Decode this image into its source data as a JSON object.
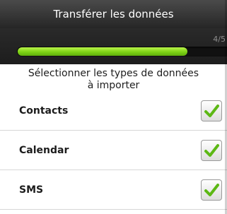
{
  "header": {
    "title": "Transférer les données"
  },
  "progress": {
    "step_label": "4/5",
    "fraction": 0.8
  },
  "panel": {
    "prompt_line1": "Sélectionner les types de données",
    "prompt_line2": "à importer",
    "items": [
      {
        "label": "Contacts",
        "checked": true
      },
      {
        "label": "Calendar",
        "checked": true
      },
      {
        "label": "SMS",
        "checked": true
      }
    ]
  },
  "colors": {
    "title_bar": "#333333",
    "progress_fill": "#7ed316",
    "checkmark": "#5cb814"
  },
  "icons": {
    "checkbox": "checkmark-icon"
  }
}
